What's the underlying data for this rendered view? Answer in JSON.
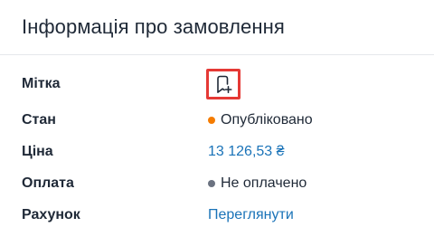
{
  "card": {
    "title": "Інформація про замовлення"
  },
  "rows": {
    "tag": {
      "label": "Мітка",
      "icon": "bookmark-plus-icon"
    },
    "status": {
      "label": "Стан",
      "value": "Опубліковано",
      "dot_color": "#f57c00"
    },
    "price": {
      "label": "Ціна",
      "value": "13 126,53 ₴"
    },
    "payment": {
      "label": "Оплата",
      "value": "Не оплачено",
      "dot_color": "#6b7280"
    },
    "invoice": {
      "label": "Рахунок",
      "value": "Переглянути"
    }
  },
  "colors": {
    "link": "#1a73b8",
    "highlight": "#e53935"
  }
}
